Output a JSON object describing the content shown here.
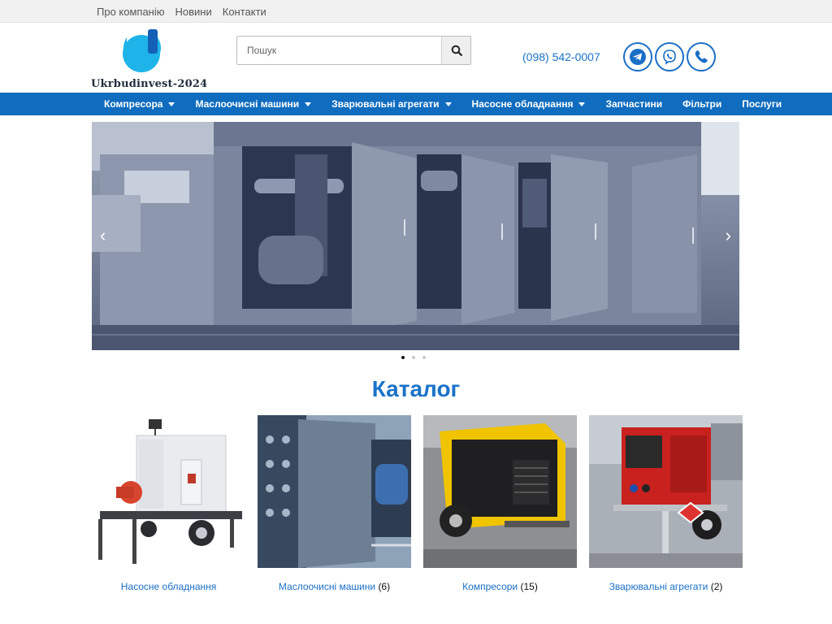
{
  "topbar": {
    "links": [
      "Про компанію",
      "Новини",
      "Контакти"
    ]
  },
  "header": {
    "brand": "Ukrbudinvest-2024",
    "search": {
      "placeholder": "Пошук"
    },
    "phone": "(098) 542-0007",
    "social_icons": [
      "telegram-icon",
      "viber-icon",
      "phone-icon"
    ]
  },
  "nav": {
    "items": [
      {
        "label": "Компресора",
        "dropdown": true
      },
      {
        "label": "Маслоочисні машини",
        "dropdown": true
      },
      {
        "label": "Зварювальні агрегати",
        "dropdown": true
      },
      {
        "label": "Насосне обладнання",
        "dropdown": true
      },
      {
        "label": "Запчастини",
        "dropdown": false
      },
      {
        "label": "Фільтри",
        "dropdown": false
      },
      {
        "label": "Послуги",
        "dropdown": false
      }
    ]
  },
  "slider": {
    "prev": "‹",
    "next": "›",
    "slides": 3,
    "active_slide": 1
  },
  "catalog": {
    "title": "Каталог",
    "cards": [
      {
        "name": "Насосне обладнання",
        "count": ""
      },
      {
        "name": "Маслоочисні машини",
        "count": "(6)"
      },
      {
        "name": "Компресори",
        "count": "(15)"
      },
      {
        "name": "Зварювальні агрегати",
        "count": "(2)"
      }
    ]
  },
  "colors": {
    "accent": "#1a73c8",
    "nav_bg": "#0f6cbf",
    "topbar_bg": "#f1f1f1"
  }
}
